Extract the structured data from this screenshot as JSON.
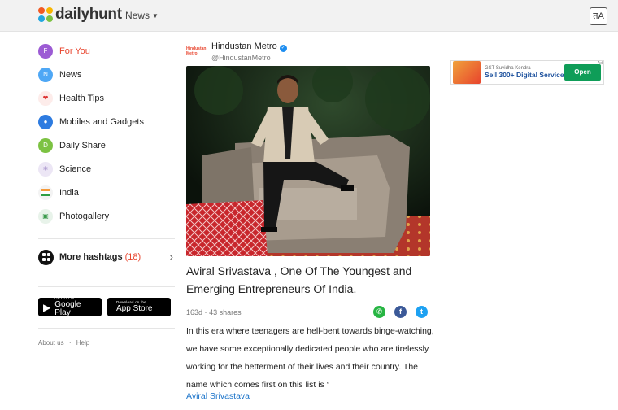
{
  "header": {
    "logo_text": "dailyhunt",
    "nav_label": "News",
    "lang_icon": "translate-icon",
    "lang_glyph": "तA"
  },
  "sidebar": {
    "items": [
      {
        "label": "For You",
        "icon": "F",
        "active": true
      },
      {
        "label": "News",
        "icon": "N"
      },
      {
        "label": "Health Tips",
        "icon": "❤"
      },
      {
        "label": "Mobiles and Gadgets",
        "icon": "●"
      },
      {
        "label": "Daily Share",
        "icon": "D"
      },
      {
        "label": "Science",
        "icon": "⚛"
      },
      {
        "label": "India",
        "icon": "flag"
      },
      {
        "label": "Photogallery",
        "icon": "▣"
      }
    ],
    "more_hashtags": {
      "label": "More hashtags",
      "count": "(18)"
    },
    "google_play": {
      "small": "GET IT ON",
      "big": "Google Play"
    },
    "app_store": {
      "small": "Download on the",
      "big": "App Store"
    },
    "footer": {
      "about": "About us",
      "sep": "·",
      "help": "Help"
    }
  },
  "article": {
    "publisher_logo_text": "Hindustan Metro",
    "publisher_name": "Hindustan Metro",
    "publisher_handle": "@HindustanMetro",
    "headline": "Aviral Srivastava , One Of The Youngest and Emerging Entrepreneurs Of India.",
    "age": "163d",
    "shares": "43 shares",
    "meta_sep": "·",
    "body": "In this era where teenagers are hell-bent towards binge-watching, we have some exceptionally dedicated people who are tirelessly working for the betterment of their lives and their country. The name which comes first on this list is ‘",
    "link": "Aviral Srivastava"
  },
  "ad": {
    "small": "GST Suvidha Kendra",
    "big": "Sell 300+ Digital Services",
    "cta": "Open",
    "badge": "Ad"
  },
  "colors": {
    "accent": "#e8442d",
    "link": "#1a73c9"
  }
}
